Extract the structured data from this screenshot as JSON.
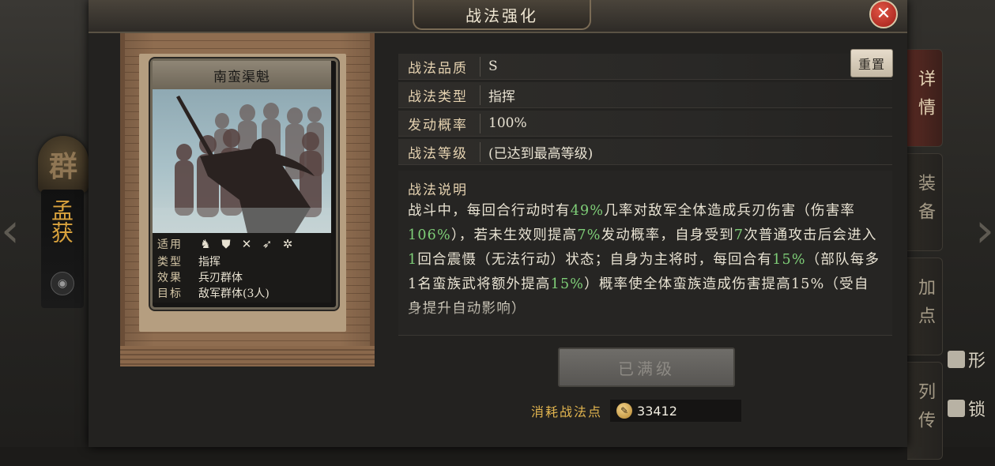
{
  "window": {
    "title": "战法强化"
  },
  "background": {
    "faction": "群",
    "general_name": "孟获",
    "right_links": [
      "形",
      "锁"
    ]
  },
  "side_tabs": [
    {
      "label": "详情",
      "active": true
    },
    {
      "label": "装备",
      "active": false
    },
    {
      "label": "加点",
      "active": false
    },
    {
      "label": "列传",
      "active": false
    }
  ],
  "card": {
    "name": "南蛮渠魁",
    "rows": [
      {
        "label": "适用",
        "value": ""
      },
      {
        "label": "类型",
        "value": "指挥"
      },
      {
        "label": "效果",
        "value": "兵刃群体"
      },
      {
        "label": "目标",
        "value": "敌军群体(3人)"
      }
    ],
    "troop_icons": [
      "cavalry-icon",
      "shield-icon",
      "bow-icon",
      "spear-icon",
      "wheel-icon"
    ]
  },
  "attributes": [
    {
      "label": "战法品质",
      "value": "S"
    },
    {
      "label": "战法类型",
      "value": "指挥"
    },
    {
      "label": "发动概率",
      "value": "100%"
    },
    {
      "label": "战法等级",
      "value": "(已达到最高等级)"
    }
  ],
  "reset_button": "重置",
  "description": {
    "title": "战法说明",
    "segments": [
      {
        "text": "战斗中，每回合行动时有",
        "hl": false
      },
      {
        "text": "49%",
        "hl": true
      },
      {
        "text": "几率对敌军全体造成兵刃伤害（伤害率",
        "hl": false
      },
      {
        "text": "106%",
        "hl": true
      },
      {
        "text": "），若未生效则提高",
        "hl": false
      },
      {
        "text": "7%",
        "hl": true
      },
      {
        "text": "发动概率，自身受到",
        "hl": false
      },
      {
        "text": "7",
        "hl": true
      },
      {
        "text": "次普通攻击后会进入",
        "hl": false
      },
      {
        "text": "1",
        "hl": true
      },
      {
        "text": "回合震慑（无法行动）状态；自身为主将时，每回合有",
        "hl": false
      },
      {
        "text": "15%",
        "hl": true
      },
      {
        "text": "（部队每多1名蛮族武将额外提高",
        "hl": false
      },
      {
        "text": "15%",
        "hl": true
      },
      {
        "text": "）概率使全体蛮族造成伤害提高15%（受自身提升自动影响）",
        "hl": false
      }
    ]
  },
  "maxed_button": "已满级",
  "cost": {
    "label": "消耗战法点",
    "value": "33412"
  },
  "colors": {
    "highlight": "#7fcf78",
    "accent": "#e2b54f",
    "close": "#c0271d"
  }
}
